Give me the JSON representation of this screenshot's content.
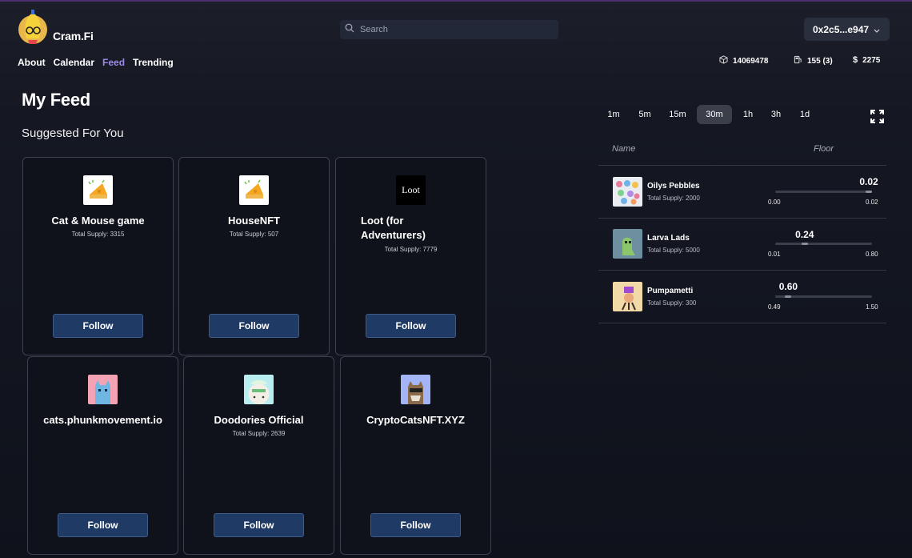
{
  "app": {
    "name": "Cram.Fi"
  },
  "search": {
    "placeholder": "Search"
  },
  "wallet": {
    "address": "0x2c5...e947"
  },
  "nav": {
    "items": [
      "About",
      "Calendar",
      "Feed",
      "Trending"
    ],
    "active": "Feed"
  },
  "stats": {
    "block": "14069478",
    "gas": "155 (3)",
    "price": "2275"
  },
  "page": {
    "title": "My Feed",
    "suggested_heading": "Suggested For You"
  },
  "cards": [
    {
      "name": "Cat & Mouse game",
      "supply": "Total Supply: 3315",
      "follow": "Follow",
      "icon": "cheese-icon"
    },
    {
      "name": "HouseNFT",
      "supply": "Total Supply: 507",
      "follow": "Follow",
      "icon": "cheese-icon"
    },
    {
      "name": "Loot (for Adventurers)",
      "supply": "Total Supply: 7779",
      "follow": "Follow",
      "icon": "loot-logo",
      "logo_text": "Loot"
    },
    {
      "name": "cats.phunkmovement.io",
      "supply": "",
      "follow": "Follow",
      "icon": "blue-cat-avatar"
    },
    {
      "name": "Doodories Official",
      "supply": "Total Supply: 2639",
      "follow": "Follow",
      "icon": "doodle-avatar"
    },
    {
      "name": "CryptoCatsNFT.XYZ",
      "supply": "",
      "follow": "Follow",
      "icon": "crypto-cat-avatar"
    }
  ],
  "timeframes": {
    "options": [
      "1m",
      "5m",
      "15m",
      "30m",
      "1h",
      "3h",
      "1d"
    ],
    "active": "30m"
  },
  "table": {
    "headers": {
      "name": "Name",
      "floor": "Floor"
    },
    "rows": [
      {
        "name": "Oilys Pebbles",
        "supply": "Total Supply: 2000",
        "floor": "0.02",
        "low": "0.00",
        "high": "0.02",
        "position": 1.0
      },
      {
        "name": "Larva Lads",
        "supply": "Total Supply: 5000",
        "floor": "0.24",
        "low": "0.01",
        "high": "0.80",
        "position": 0.29
      },
      {
        "name": "Pumpametti",
        "supply": "Total Supply: 300",
        "floor": "0.60",
        "low": "0.49",
        "high": "1.50",
        "position": 0.11
      }
    ]
  },
  "colors": {
    "accent": "#9c8be6",
    "button": "#1f3a64",
    "background": "#0f121b"
  }
}
